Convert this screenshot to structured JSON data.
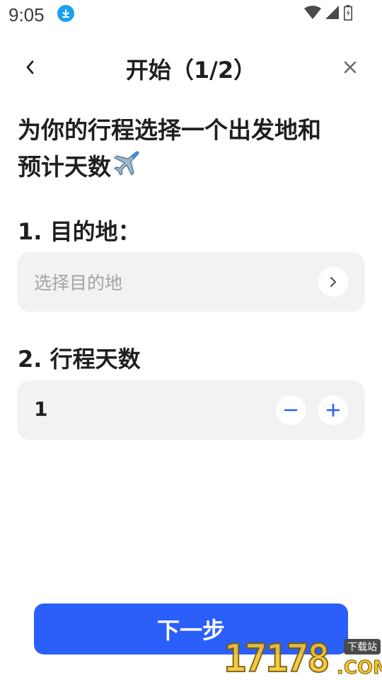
{
  "status_bar": {
    "time": "9:05",
    "icons": [
      "download-badge-icon",
      "wifi-icon",
      "signal-icon",
      "battery-icon"
    ]
  },
  "header": {
    "title": "开始（1/2）",
    "back_icon": "chevron-left-icon",
    "close_icon": "close-icon"
  },
  "headline": {
    "line1": "为你的行程选择一个出发地和",
    "line2": "预计天数",
    "emoji": "airplane-icon"
  },
  "destination": {
    "label": "1. 目的地：",
    "placeholder": "选择目的地",
    "action_icon": "chevron-right-icon"
  },
  "days": {
    "label": "2. 行程天数",
    "value": "1",
    "decrement_icon": "minus-icon",
    "increment_icon": "plus-icon"
  },
  "footer": {
    "next_label": "下一步"
  },
  "watermark": {
    "digits": "17178",
    "suffix": ".COM",
    "tag": "下载站"
  },
  "colors": {
    "primary": "#2a5ffa",
    "field_bg": "#f2f2f2",
    "placeholder": "#a3a3a3",
    "text": "#1f1f1f"
  }
}
